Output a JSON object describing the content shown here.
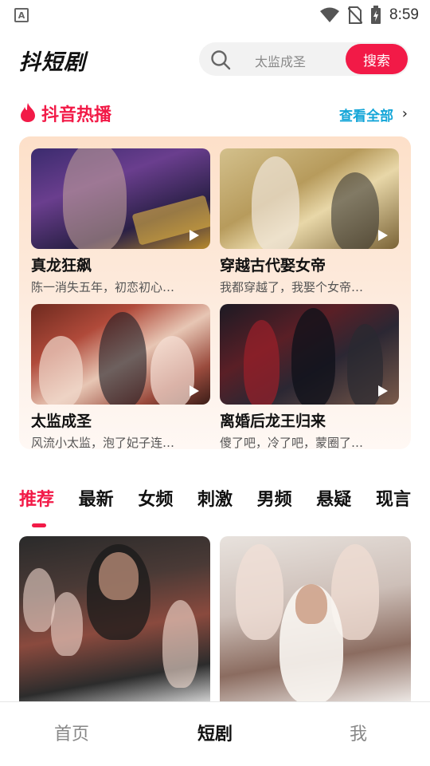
{
  "status_bar": {
    "time": "8:59",
    "notification_icon_letter": "A"
  },
  "header": {
    "brand": "抖短剧",
    "search_placeholder": "太监成圣",
    "search_button": "搜索"
  },
  "hot_section": {
    "title": "抖音热播",
    "view_all": "查看全部",
    "items": [
      {
        "title": "真龙狂飙",
        "desc": "陈一消失五年，初恋初心…"
      },
      {
        "title": "穿越古代娶女帝",
        "desc": "我都穿越了，我娶个女帝…"
      },
      {
        "title": "太监成圣",
        "desc": "风流小太监，泡了妃子连…"
      },
      {
        "title": "离婚后龙王归来",
        "desc": "傻了吧，冷了吧，蒙圈了…"
      }
    ]
  },
  "tabs": [
    "推荐",
    "最新",
    "女频",
    "刺激",
    "男频",
    "悬疑",
    "现言"
  ],
  "active_tab": "推荐",
  "bottom_nav": [
    "首页",
    "短剧",
    "我"
  ],
  "active_nav": "短剧",
  "colors": {
    "accent": "#f21a47",
    "link": "#15a6d8"
  }
}
